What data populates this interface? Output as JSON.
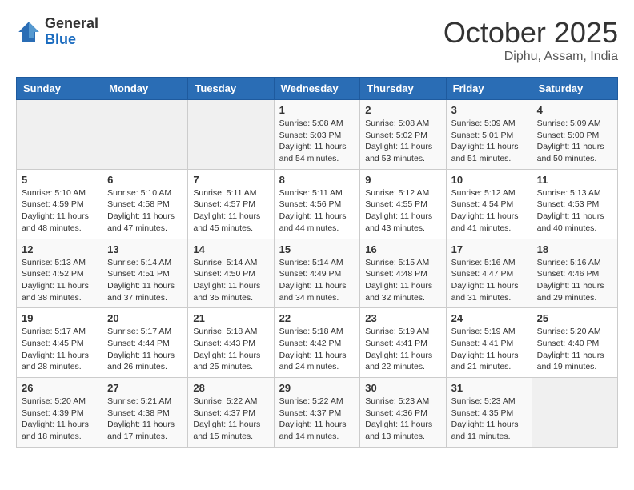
{
  "header": {
    "logo_general": "General",
    "logo_blue": "Blue",
    "month": "October 2025",
    "location": "Diphu, Assam, India"
  },
  "days_of_week": [
    "Sunday",
    "Monday",
    "Tuesday",
    "Wednesday",
    "Thursday",
    "Friday",
    "Saturday"
  ],
  "weeks": [
    [
      {
        "day": "",
        "info": ""
      },
      {
        "day": "",
        "info": ""
      },
      {
        "day": "",
        "info": ""
      },
      {
        "day": "1",
        "info": "Sunrise: 5:08 AM\nSunset: 5:03 PM\nDaylight: 11 hours\nand 54 minutes."
      },
      {
        "day": "2",
        "info": "Sunrise: 5:08 AM\nSunset: 5:02 PM\nDaylight: 11 hours\nand 53 minutes."
      },
      {
        "day": "3",
        "info": "Sunrise: 5:09 AM\nSunset: 5:01 PM\nDaylight: 11 hours\nand 51 minutes."
      },
      {
        "day": "4",
        "info": "Sunrise: 5:09 AM\nSunset: 5:00 PM\nDaylight: 11 hours\nand 50 minutes."
      }
    ],
    [
      {
        "day": "5",
        "info": "Sunrise: 5:10 AM\nSunset: 4:59 PM\nDaylight: 11 hours\nand 48 minutes."
      },
      {
        "day": "6",
        "info": "Sunrise: 5:10 AM\nSunset: 4:58 PM\nDaylight: 11 hours\nand 47 minutes."
      },
      {
        "day": "7",
        "info": "Sunrise: 5:11 AM\nSunset: 4:57 PM\nDaylight: 11 hours\nand 45 minutes."
      },
      {
        "day": "8",
        "info": "Sunrise: 5:11 AM\nSunset: 4:56 PM\nDaylight: 11 hours\nand 44 minutes."
      },
      {
        "day": "9",
        "info": "Sunrise: 5:12 AM\nSunset: 4:55 PM\nDaylight: 11 hours\nand 43 minutes."
      },
      {
        "day": "10",
        "info": "Sunrise: 5:12 AM\nSunset: 4:54 PM\nDaylight: 11 hours\nand 41 minutes."
      },
      {
        "day": "11",
        "info": "Sunrise: 5:13 AM\nSunset: 4:53 PM\nDaylight: 11 hours\nand 40 minutes."
      }
    ],
    [
      {
        "day": "12",
        "info": "Sunrise: 5:13 AM\nSunset: 4:52 PM\nDaylight: 11 hours\nand 38 minutes."
      },
      {
        "day": "13",
        "info": "Sunrise: 5:14 AM\nSunset: 4:51 PM\nDaylight: 11 hours\nand 37 minutes."
      },
      {
        "day": "14",
        "info": "Sunrise: 5:14 AM\nSunset: 4:50 PM\nDaylight: 11 hours\nand 35 minutes."
      },
      {
        "day": "15",
        "info": "Sunrise: 5:14 AM\nSunset: 4:49 PM\nDaylight: 11 hours\nand 34 minutes."
      },
      {
        "day": "16",
        "info": "Sunrise: 5:15 AM\nSunset: 4:48 PM\nDaylight: 11 hours\nand 32 minutes."
      },
      {
        "day": "17",
        "info": "Sunrise: 5:16 AM\nSunset: 4:47 PM\nDaylight: 11 hours\nand 31 minutes."
      },
      {
        "day": "18",
        "info": "Sunrise: 5:16 AM\nSunset: 4:46 PM\nDaylight: 11 hours\nand 29 minutes."
      }
    ],
    [
      {
        "day": "19",
        "info": "Sunrise: 5:17 AM\nSunset: 4:45 PM\nDaylight: 11 hours\nand 28 minutes."
      },
      {
        "day": "20",
        "info": "Sunrise: 5:17 AM\nSunset: 4:44 PM\nDaylight: 11 hours\nand 26 minutes."
      },
      {
        "day": "21",
        "info": "Sunrise: 5:18 AM\nSunset: 4:43 PM\nDaylight: 11 hours\nand 25 minutes."
      },
      {
        "day": "22",
        "info": "Sunrise: 5:18 AM\nSunset: 4:42 PM\nDaylight: 11 hours\nand 24 minutes."
      },
      {
        "day": "23",
        "info": "Sunrise: 5:19 AM\nSunset: 4:41 PM\nDaylight: 11 hours\nand 22 minutes."
      },
      {
        "day": "24",
        "info": "Sunrise: 5:19 AM\nSunset: 4:41 PM\nDaylight: 11 hours\nand 21 minutes."
      },
      {
        "day": "25",
        "info": "Sunrise: 5:20 AM\nSunset: 4:40 PM\nDaylight: 11 hours\nand 19 minutes."
      }
    ],
    [
      {
        "day": "26",
        "info": "Sunrise: 5:20 AM\nSunset: 4:39 PM\nDaylight: 11 hours\nand 18 minutes."
      },
      {
        "day": "27",
        "info": "Sunrise: 5:21 AM\nSunset: 4:38 PM\nDaylight: 11 hours\nand 17 minutes."
      },
      {
        "day": "28",
        "info": "Sunrise: 5:22 AM\nSunset: 4:37 PM\nDaylight: 11 hours\nand 15 minutes."
      },
      {
        "day": "29",
        "info": "Sunrise: 5:22 AM\nSunset: 4:37 PM\nDaylight: 11 hours\nand 14 minutes."
      },
      {
        "day": "30",
        "info": "Sunrise: 5:23 AM\nSunset: 4:36 PM\nDaylight: 11 hours\nand 13 minutes."
      },
      {
        "day": "31",
        "info": "Sunrise: 5:23 AM\nSunset: 4:35 PM\nDaylight: 11 hours\nand 11 minutes."
      },
      {
        "day": "",
        "info": ""
      }
    ]
  ]
}
